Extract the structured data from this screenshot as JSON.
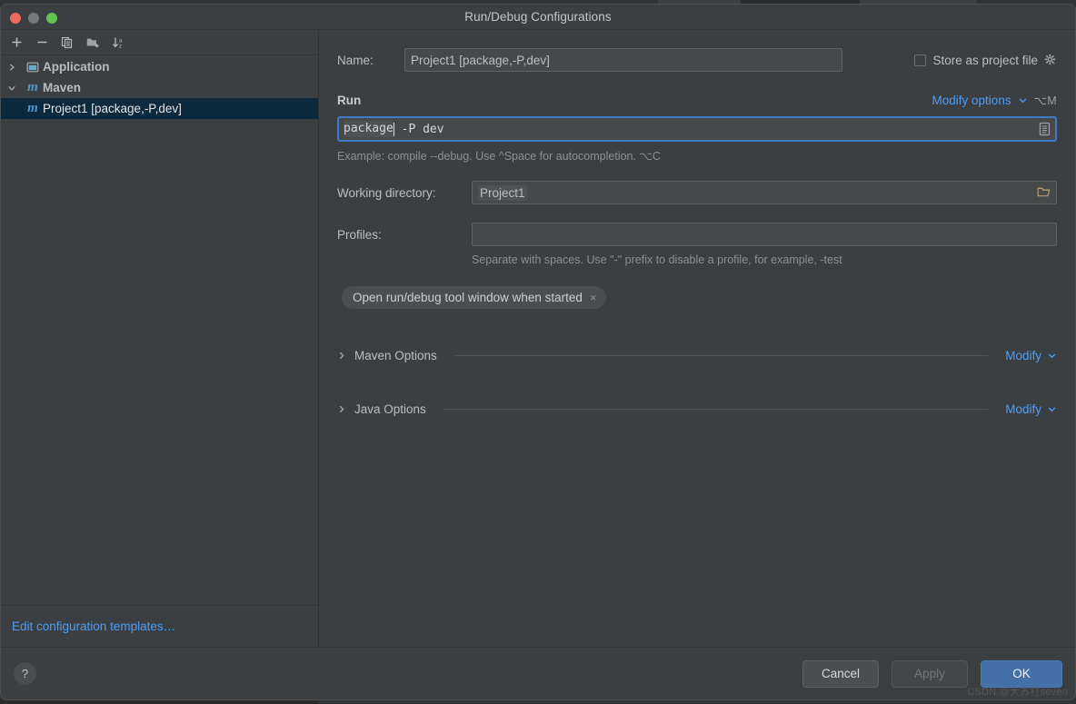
{
  "window": {
    "title": "Run/Debug Configurations",
    "traffic_lights": [
      "close",
      "minimize",
      "zoom"
    ]
  },
  "sidebar": {
    "toolbar": [
      {
        "name": "add-configuration",
        "icon": "plus-icon"
      },
      {
        "name": "remove-configuration",
        "icon": "minus-icon"
      },
      {
        "name": "copy-configuration",
        "icon": "copy-icon"
      },
      {
        "name": "new-folder",
        "icon": "folder-plus-icon"
      },
      {
        "name": "sort-configurations",
        "icon": "sort-az-icon"
      }
    ],
    "tree": [
      {
        "label": "Application",
        "icon": "application-icon",
        "expanded": false,
        "level": 0,
        "selected": false
      },
      {
        "label": "Maven",
        "icon": "maven-icon",
        "expanded": true,
        "level": 0,
        "selected": false
      },
      {
        "label": "Project1 [package,-P,dev]",
        "icon": "maven-icon",
        "level": 1,
        "selected": true
      }
    ],
    "footer_link": "Edit configuration templates…"
  },
  "form": {
    "name_label": "Name:",
    "name_value": "Project1 [package,-P,dev]",
    "name_placeholder": "Name",
    "store_as_project_file_label": "Store as project file",
    "store_as_project_file_checked": false,
    "run_section_title": "Run",
    "modify_options_label": "Modify options",
    "modify_options_shortcut": "⌥M",
    "command_selected": "package",
    "command_rest": " -P dev",
    "command_full": "package -P dev",
    "command_hint": "Example: compile --debug. Use ^Space for autocompletion. ⌥C",
    "working_directory_label": "Working directory:",
    "working_directory_value": "Project1",
    "profiles_label": "Profiles:",
    "profiles_value": "",
    "profiles_hint": "Separate with spaces. Use \"-\" prefix to disable a profile, for example, -test",
    "pill_label": "Open run/debug tool window when started",
    "pill_remove": "×",
    "sections": [
      {
        "title": "Maven Options",
        "modify_label": "Modify",
        "expanded": false
      },
      {
        "title": "Java Options",
        "modify_label": "Modify",
        "expanded": false
      }
    ]
  },
  "footer": {
    "help_label": "?",
    "cancel_label": "Cancel",
    "apply_label": "Apply",
    "apply_enabled": false,
    "ok_label": "OK",
    "watermark": "CSDN @大苏打seven"
  },
  "colors": {
    "dialog_bg": "#3c3f41",
    "field_bg": "#45494a",
    "selection_row": "#0d293e",
    "link_blue": "#4d9ef7",
    "focus_border": "#3f7bc4",
    "primary_button": "#4470a8",
    "maven_icon": "#4a9ad4"
  }
}
